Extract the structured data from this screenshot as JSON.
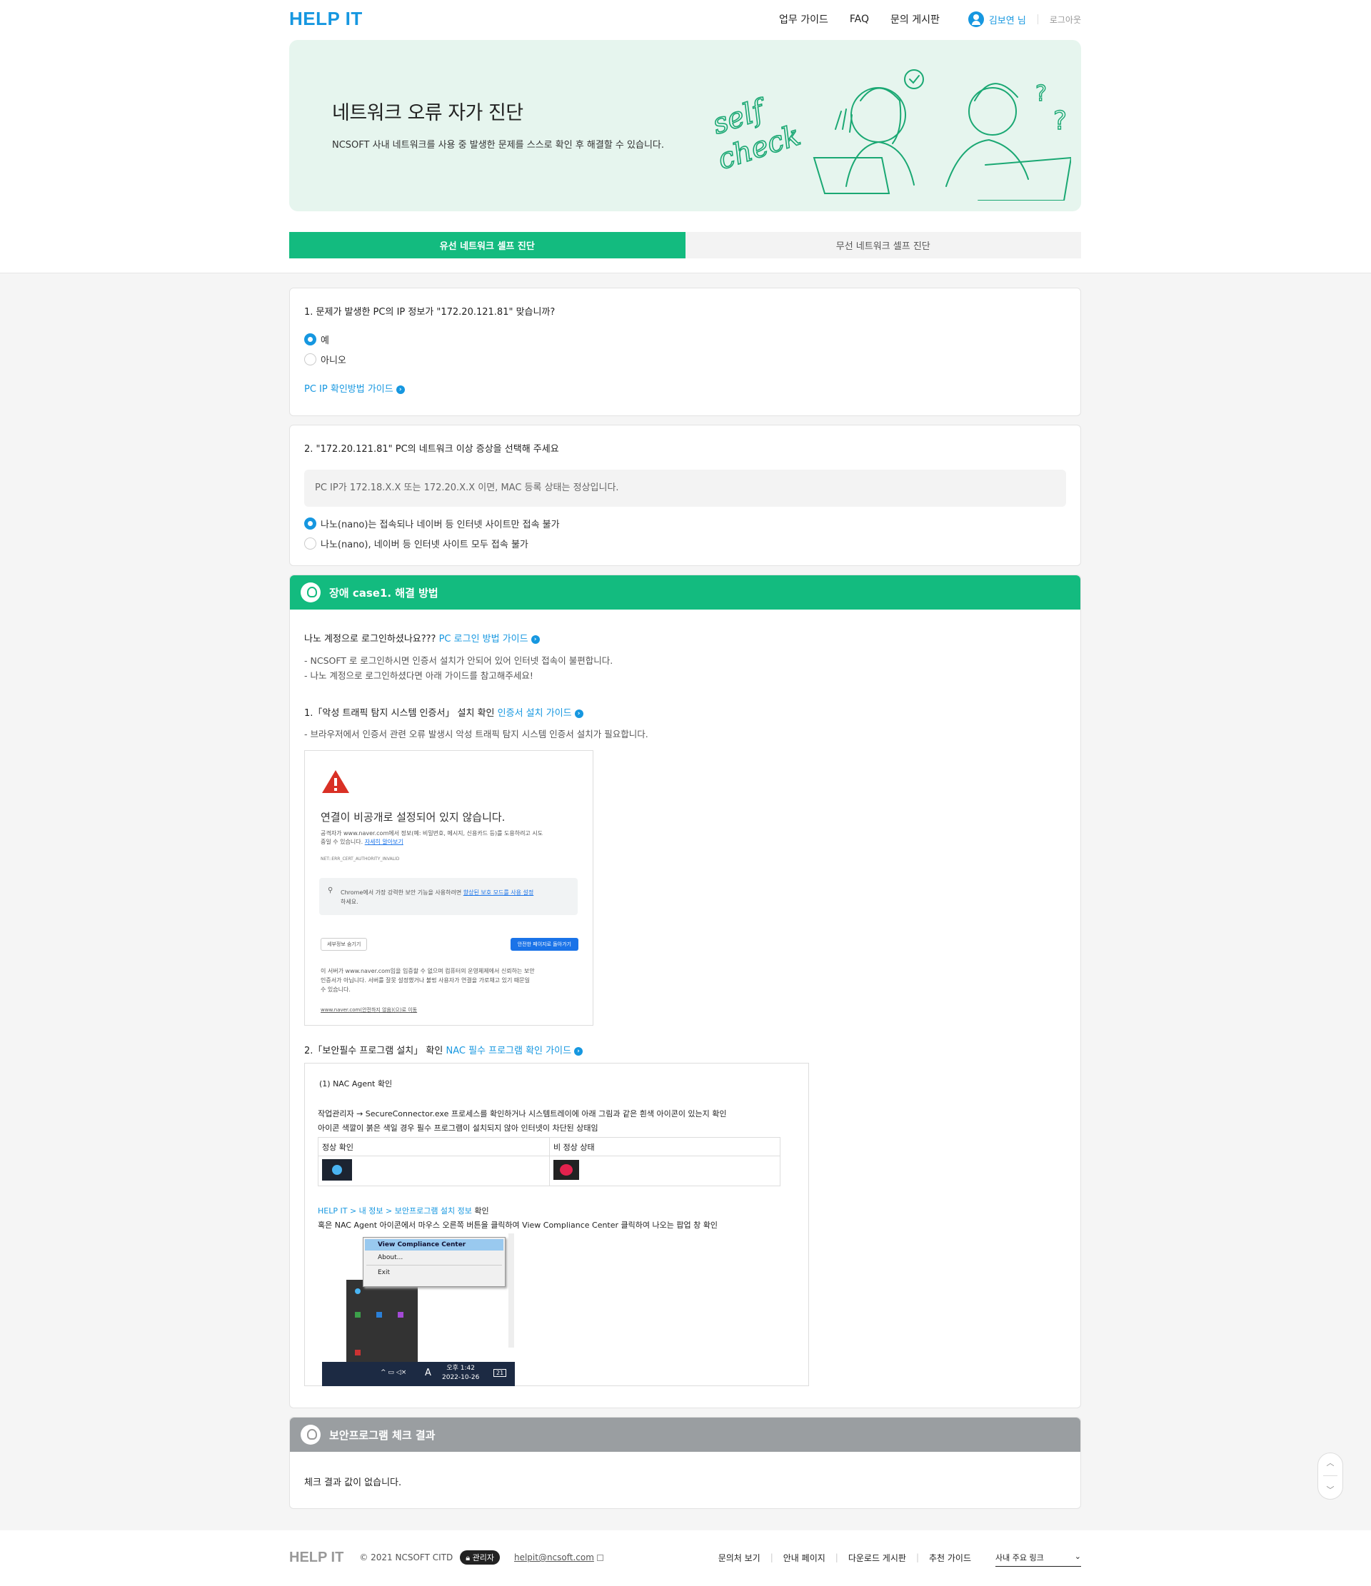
{
  "header": {
    "logo": "HELP IT",
    "nav": [
      "업무 가이드",
      "FAQ",
      "문의 게시판"
    ],
    "user": "김보연 님",
    "logout": "로그아웃"
  },
  "banner": {
    "title": "네트워크 오류 자가 진단",
    "desc": "NCSOFT 사내 네트워크를 사용 중 발생한 문제를 스스로 확인 후 해결할 수 있습니다.",
    "illus_text1": "self",
    "illus_text2": "check"
  },
  "tabs": [
    "유선 네트워크 셀프 진단",
    "무선 네트워크 셀프 진단"
  ],
  "q1": {
    "question": "1. 문제가 발생한 PC의 IP 정보가 \"172.20.121.81\" 맞습니까?",
    "options": [
      "예",
      "아니오"
    ],
    "guide": "PC IP 확인방법 가이드"
  },
  "q2": {
    "question": "2. \"172.20.121.81\" PC의 네트워크 이상 증상을 선택해 주세요",
    "note": "PC IP가 172.18.X.X 또는 172.20.X.X 이면, MAC 등록 상태는 정상입니다.",
    "options": [
      "나노(nano)는 접속되나 네이버 등 인터넷 사이트만 접속 불가",
      "나노(nano), 네이버 등 인터넷 사이트 모두 접속 불가"
    ]
  },
  "case": {
    "title": "장애 case1. 해결 방법",
    "login_q": "나노 계정으로 로그인하셨나요???",
    "login_link": "PC 로그인 방법 가이드",
    "login_desc1": "- NCSOFT 로 로그인하시면 인증서 설치가 안되어 있어 인터넷 접속이 불편합니다.",
    "login_desc2": "- 나노 계정으로 로그인하셨다면 아래 가이드를 참고해주세요!",
    "s1_title": "1.「악성 트래픽 탐지 시스템 인증서」 설치 확인",
    "s1_link": "인증서 설치 가이드",
    "s1_desc": "- 브라우저에서 인증서 관련 오류 발생시 악성 트래픽 탐지 시스템 인증서 설치가 필요합니다.",
    "s2_title": "2.「보안필수 프로그램 설치」 확인",
    "s2_link": "NAC 필수 프로그램 확인 가이드"
  },
  "chrome": {
    "title": "연결이 비공개로 설정되어 있지 않습니다.",
    "body1": "공격자가 www.naver.com에서 정보(예: 비밀번호, 메시지, 신용카드 등)를 도용하려고 시도",
    "body2": "중일 수 있습니다.",
    "more": "자세히 알아보기",
    "code": "NET::ERR_CERT_AUTHORITY_INVALID",
    "tip1": "Chrome에서 가장 강력한 보안 기능을 사용하려면",
    "tip_link": "향상된 보호 모드를 사용 설정",
    "tip2": "하세요.",
    "btn_detail": "세부정보 숨기기",
    "btn_back": "안전한 페이지로 돌아가기",
    "detail1": "이 서버가 www.naver.com임을 입증할 수 없으며 컴퓨터의 운영체제에서 신뢰하는 보안",
    "detail2": "인증서가 아닙니다. 서버를 잘못 설정했거나 불법 사용자가 연결을 가로채고 있기 때문일",
    "detail3": "수 있습니다.",
    "proceed": "www.naver.com(안전하지 않음)(으)로 이동"
  },
  "nac": {
    "heading": "(1) NAC Agent 확인",
    "line1": "작업관리자 → SecureConnector.exe 프로세스를 확인하거나 시스템트레이에 아래 그림과 같은 흰색 아이콘이 있는지 확인",
    "line2": "아이콘 색깔이 붉은 색일 경우 필수 프로그램이 설치되지 않아 인터넷이 차단된 상태임",
    "col_ok": "정상 확인",
    "col_bad": "비 정상 상태",
    "path": "HELP IT > 내 정보 > 보안프로그램 설치 정보",
    "path_suffix": " 확인",
    "line3": "혹은 NAC Agent 아이콘에서 마우스 오른쪽 버튼을 클릭하여 View Compliance Center 클릭하여 나오는 팝업 창 확인",
    "menu": [
      "View Compliance Center",
      "About...",
      "Exit"
    ],
    "time": "오후 1:42",
    "date": "2022-10-26",
    "ime": "A",
    "notif": "21"
  },
  "result": {
    "title": "보안프로그램 체크 결과",
    "text": "체크 결과 값이 없습니다."
  },
  "footer": {
    "logo": "HELP IT",
    "copy": "© 2021 NCSOFT CITD",
    "badge": "관리자",
    "email": "helpit@ncsoft.com",
    "links": [
      "문의처 보기",
      "안내 페이지",
      "다운로드 게시판",
      "추천 가이드"
    ],
    "select": "사내 주요 링크"
  },
  "colors": {
    "accent": "#1697e0",
    "green": "#13bb7f",
    "grey_head": "#9a9ea1"
  }
}
